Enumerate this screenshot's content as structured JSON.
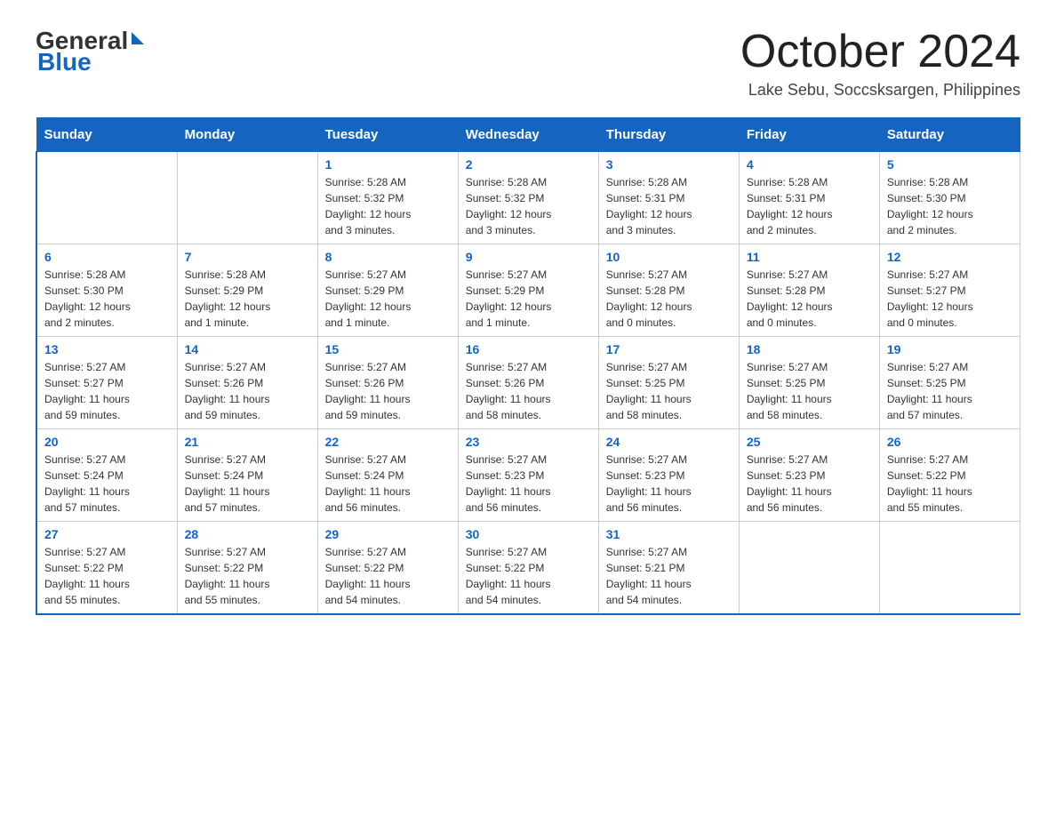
{
  "header": {
    "logo_general": "General",
    "logo_blue": "Blue",
    "month_title": "October 2024",
    "location": "Lake Sebu, Soccsksargen, Philippines"
  },
  "days_of_week": [
    "Sunday",
    "Monday",
    "Tuesday",
    "Wednesday",
    "Thursday",
    "Friday",
    "Saturday"
  ],
  "weeks": [
    [
      {
        "day": "",
        "info": ""
      },
      {
        "day": "",
        "info": ""
      },
      {
        "day": "1",
        "info": "Sunrise: 5:28 AM\nSunset: 5:32 PM\nDaylight: 12 hours\nand 3 minutes."
      },
      {
        "day": "2",
        "info": "Sunrise: 5:28 AM\nSunset: 5:32 PM\nDaylight: 12 hours\nand 3 minutes."
      },
      {
        "day": "3",
        "info": "Sunrise: 5:28 AM\nSunset: 5:31 PM\nDaylight: 12 hours\nand 3 minutes."
      },
      {
        "day": "4",
        "info": "Sunrise: 5:28 AM\nSunset: 5:31 PM\nDaylight: 12 hours\nand 2 minutes."
      },
      {
        "day": "5",
        "info": "Sunrise: 5:28 AM\nSunset: 5:30 PM\nDaylight: 12 hours\nand 2 minutes."
      }
    ],
    [
      {
        "day": "6",
        "info": "Sunrise: 5:28 AM\nSunset: 5:30 PM\nDaylight: 12 hours\nand 2 minutes."
      },
      {
        "day": "7",
        "info": "Sunrise: 5:28 AM\nSunset: 5:29 PM\nDaylight: 12 hours\nand 1 minute."
      },
      {
        "day": "8",
        "info": "Sunrise: 5:27 AM\nSunset: 5:29 PM\nDaylight: 12 hours\nand 1 minute."
      },
      {
        "day": "9",
        "info": "Sunrise: 5:27 AM\nSunset: 5:29 PM\nDaylight: 12 hours\nand 1 minute."
      },
      {
        "day": "10",
        "info": "Sunrise: 5:27 AM\nSunset: 5:28 PM\nDaylight: 12 hours\nand 0 minutes."
      },
      {
        "day": "11",
        "info": "Sunrise: 5:27 AM\nSunset: 5:28 PM\nDaylight: 12 hours\nand 0 minutes."
      },
      {
        "day": "12",
        "info": "Sunrise: 5:27 AM\nSunset: 5:27 PM\nDaylight: 12 hours\nand 0 minutes."
      }
    ],
    [
      {
        "day": "13",
        "info": "Sunrise: 5:27 AM\nSunset: 5:27 PM\nDaylight: 11 hours\nand 59 minutes."
      },
      {
        "day": "14",
        "info": "Sunrise: 5:27 AM\nSunset: 5:26 PM\nDaylight: 11 hours\nand 59 minutes."
      },
      {
        "day": "15",
        "info": "Sunrise: 5:27 AM\nSunset: 5:26 PM\nDaylight: 11 hours\nand 59 minutes."
      },
      {
        "day": "16",
        "info": "Sunrise: 5:27 AM\nSunset: 5:26 PM\nDaylight: 11 hours\nand 58 minutes."
      },
      {
        "day": "17",
        "info": "Sunrise: 5:27 AM\nSunset: 5:25 PM\nDaylight: 11 hours\nand 58 minutes."
      },
      {
        "day": "18",
        "info": "Sunrise: 5:27 AM\nSunset: 5:25 PM\nDaylight: 11 hours\nand 58 minutes."
      },
      {
        "day": "19",
        "info": "Sunrise: 5:27 AM\nSunset: 5:25 PM\nDaylight: 11 hours\nand 57 minutes."
      }
    ],
    [
      {
        "day": "20",
        "info": "Sunrise: 5:27 AM\nSunset: 5:24 PM\nDaylight: 11 hours\nand 57 minutes."
      },
      {
        "day": "21",
        "info": "Sunrise: 5:27 AM\nSunset: 5:24 PM\nDaylight: 11 hours\nand 57 minutes."
      },
      {
        "day": "22",
        "info": "Sunrise: 5:27 AM\nSunset: 5:24 PM\nDaylight: 11 hours\nand 56 minutes."
      },
      {
        "day": "23",
        "info": "Sunrise: 5:27 AM\nSunset: 5:23 PM\nDaylight: 11 hours\nand 56 minutes."
      },
      {
        "day": "24",
        "info": "Sunrise: 5:27 AM\nSunset: 5:23 PM\nDaylight: 11 hours\nand 56 minutes."
      },
      {
        "day": "25",
        "info": "Sunrise: 5:27 AM\nSunset: 5:23 PM\nDaylight: 11 hours\nand 56 minutes."
      },
      {
        "day": "26",
        "info": "Sunrise: 5:27 AM\nSunset: 5:22 PM\nDaylight: 11 hours\nand 55 minutes."
      }
    ],
    [
      {
        "day": "27",
        "info": "Sunrise: 5:27 AM\nSunset: 5:22 PM\nDaylight: 11 hours\nand 55 minutes."
      },
      {
        "day": "28",
        "info": "Sunrise: 5:27 AM\nSunset: 5:22 PM\nDaylight: 11 hours\nand 55 minutes."
      },
      {
        "day": "29",
        "info": "Sunrise: 5:27 AM\nSunset: 5:22 PM\nDaylight: 11 hours\nand 54 minutes."
      },
      {
        "day": "30",
        "info": "Sunrise: 5:27 AM\nSunset: 5:22 PM\nDaylight: 11 hours\nand 54 minutes."
      },
      {
        "day": "31",
        "info": "Sunrise: 5:27 AM\nSunset: 5:21 PM\nDaylight: 11 hours\nand 54 minutes."
      },
      {
        "day": "",
        "info": ""
      },
      {
        "day": "",
        "info": ""
      }
    ]
  ]
}
